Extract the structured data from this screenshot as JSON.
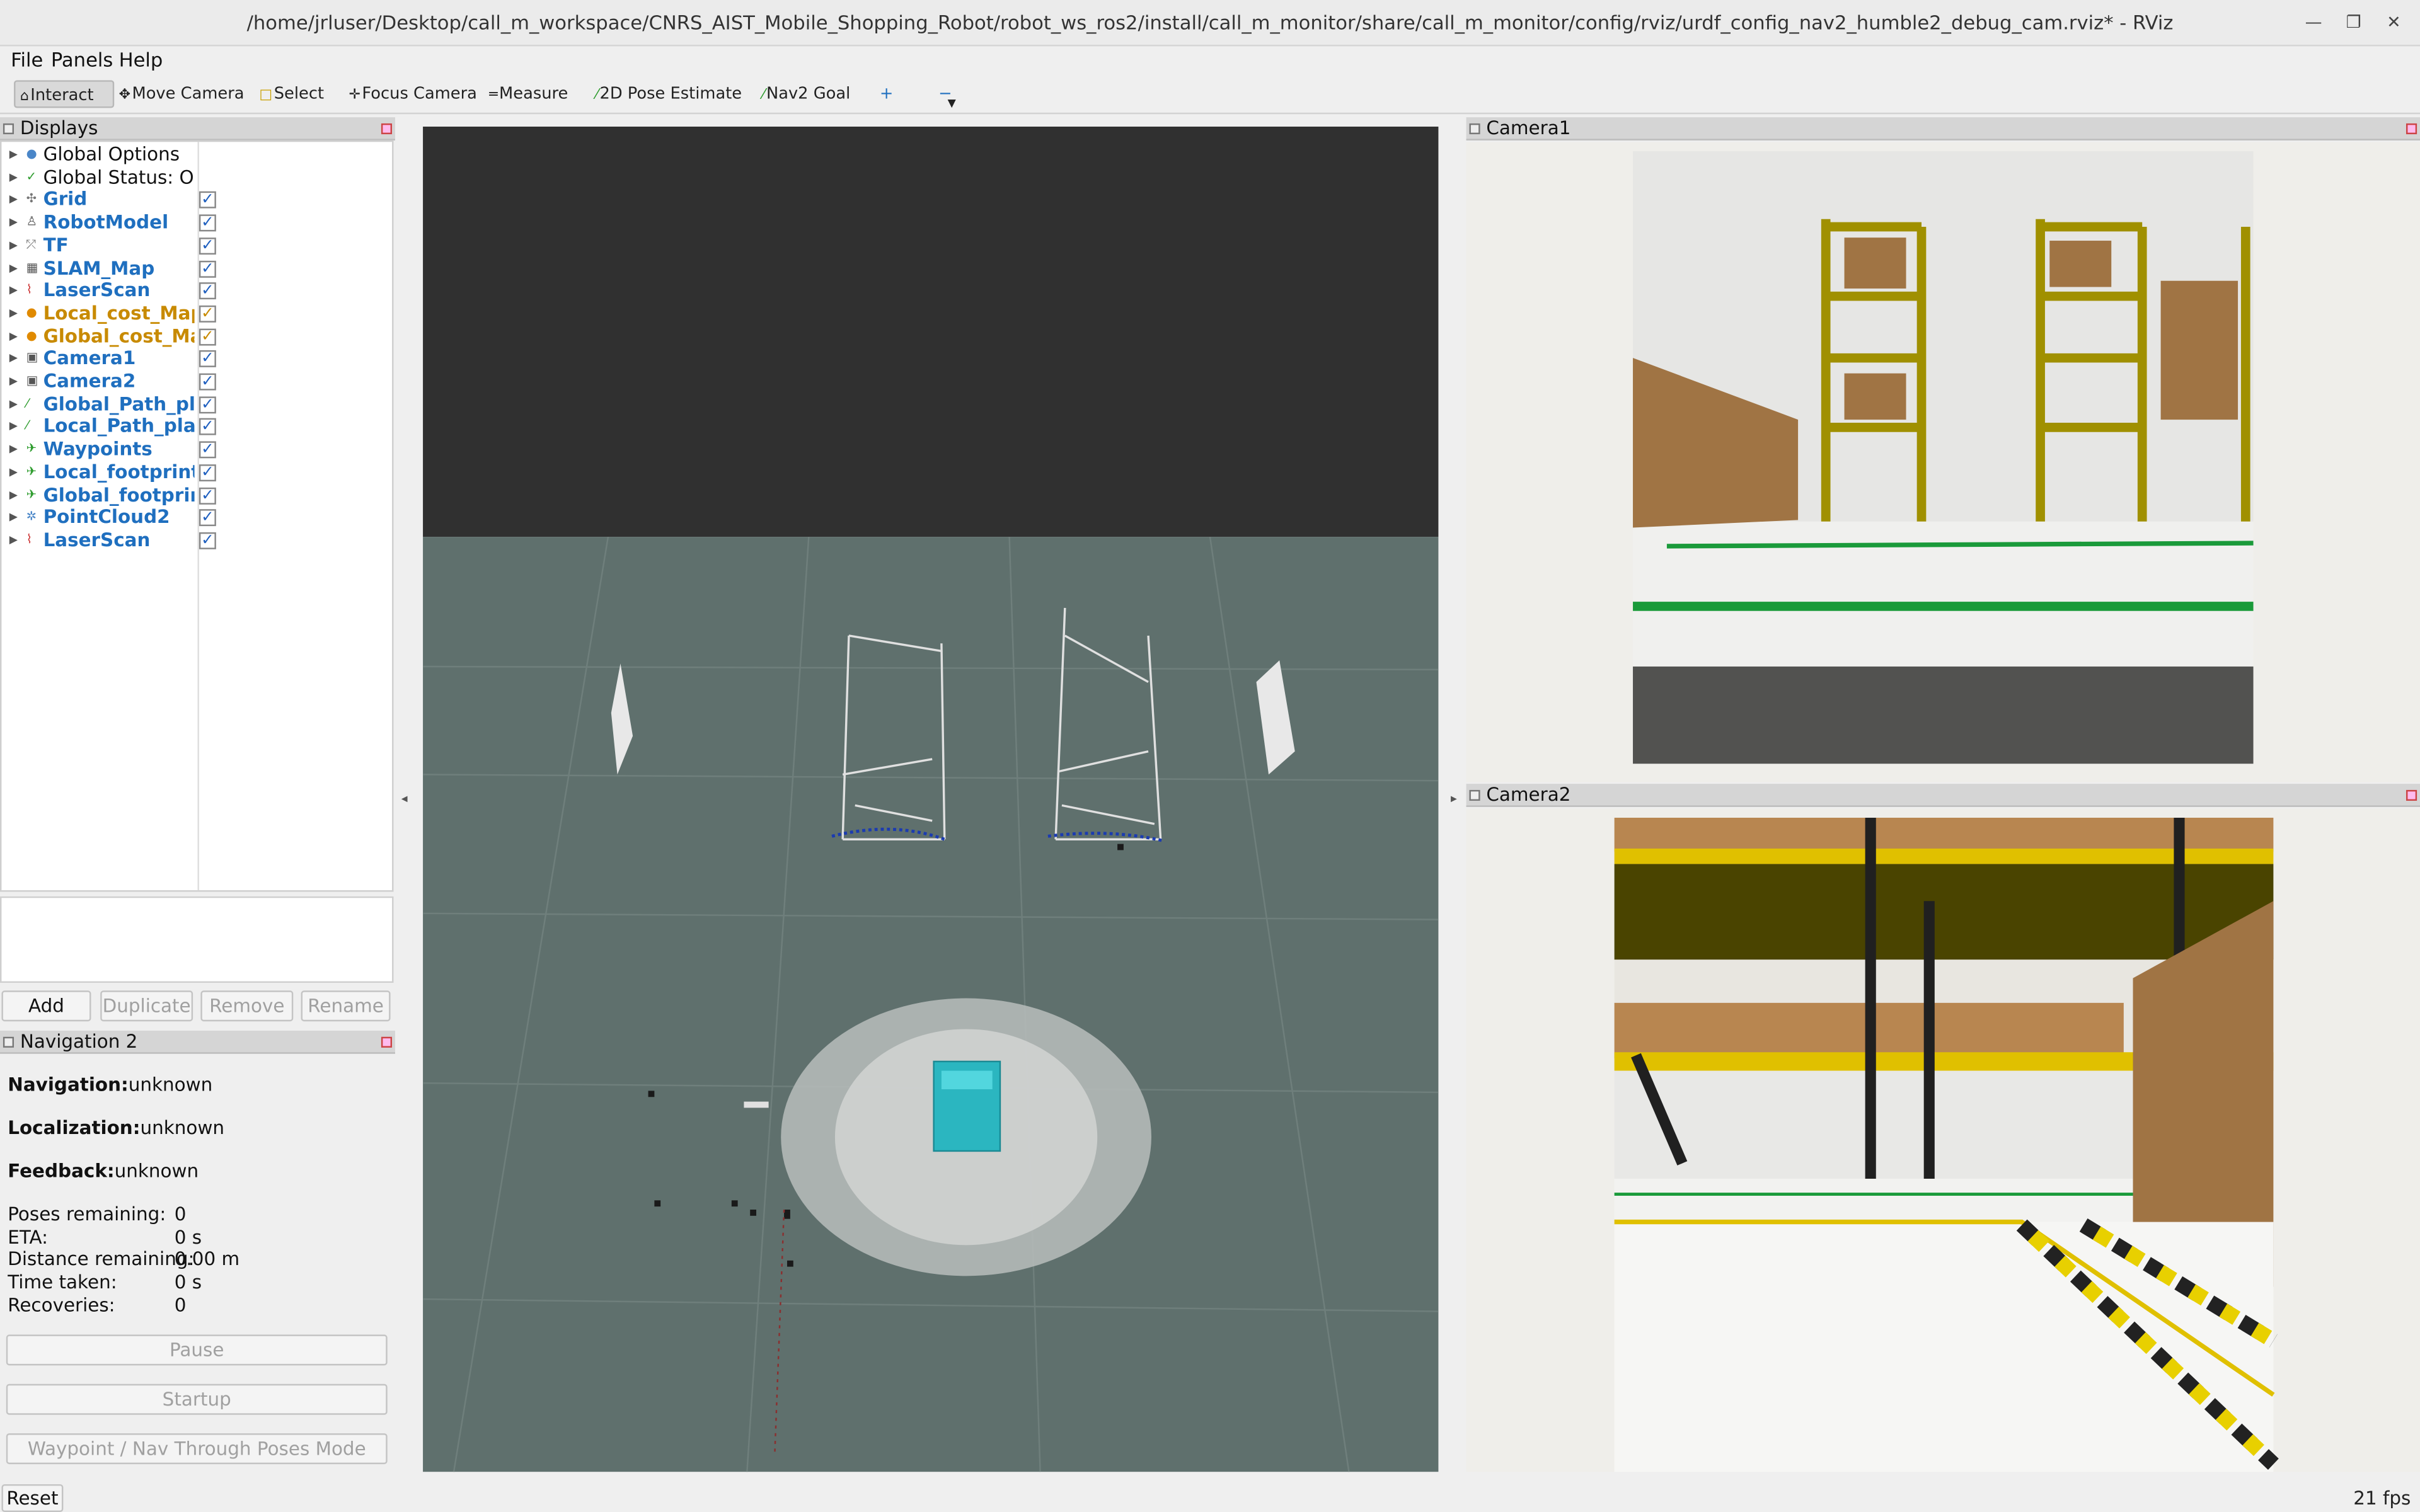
{
  "window": {
    "title": "/home/jrluser/Desktop/call_m_workspace/CNRS_AIST_Mobile_Shopping_Robot/robot_ws_ros2/install/call_m_monitor/share/call_m_monitor/config/rviz/urdf_config_nav2_humble2_debug_cam.rviz* - RViz"
  },
  "menu": {
    "file": "File",
    "panels": "Panels",
    "help": "Help"
  },
  "toolbar": {
    "interact": "Interact",
    "move_camera": "Move Camera",
    "select": "Select",
    "focus_camera": "Focus Camera",
    "measure": "Measure",
    "pose_estimate": "2D Pose Estimate",
    "nav2_goal": "Nav2 Goal",
    "plus": "+",
    "minus": "−"
  },
  "displays": {
    "title": "Displays",
    "items": [
      {
        "label": "Global Options",
        "color": "#111111",
        "checked": false,
        "has_check": false,
        "icon_color": "#4a86c8"
      },
      {
        "label": "Global Status: Ok",
        "color": "#111111",
        "checked": false,
        "has_check": false,
        "icon_color": "#2a9a2a"
      },
      {
        "label": "Grid",
        "color": "#1f6fbf",
        "checked": true,
        "has_check": true,
        "icon_color": "#777777"
      },
      {
        "label": "RobotModel",
        "color": "#1f6fbf",
        "checked": true,
        "has_check": true,
        "icon_color": "#555555"
      },
      {
        "label": "TF",
        "color": "#1f6fbf",
        "checked": true,
        "has_check": true,
        "icon_color": "#888888"
      },
      {
        "label": "SLAM_Map",
        "color": "#1f6fbf",
        "checked": true,
        "has_check": true,
        "icon_color": "#555555"
      },
      {
        "label": "LaserScan",
        "color": "#1f6fbf",
        "checked": true,
        "has_check": true,
        "icon_color": "#cc3333"
      },
      {
        "label": "Local_cost_Map",
        "color": "#c88a00",
        "checked": true,
        "has_check": true,
        "icon_color": "#e08a00"
      },
      {
        "label": "Global_cost_Map",
        "color": "#c88a00",
        "checked": true,
        "has_check": true,
        "icon_color": "#e08a00"
      },
      {
        "label": "Camera1",
        "color": "#1f6fbf",
        "checked": true,
        "has_check": true,
        "icon_color": "#555555"
      },
      {
        "label": "Camera2",
        "color": "#1f6fbf",
        "checked": true,
        "has_check": true,
        "icon_color": "#555555"
      },
      {
        "label": "Global_Path_pl...",
        "color": "#1f6fbf",
        "checked": true,
        "has_check": true,
        "icon_color": "#2a9a2a"
      },
      {
        "label": "Local_Path_pla...",
        "color": "#1f6fbf",
        "checked": true,
        "has_check": true,
        "icon_color": "#2a9a2a"
      },
      {
        "label": "Waypoints",
        "color": "#1f6fbf",
        "checked": true,
        "has_check": true,
        "icon_color": "#2a9a2a"
      },
      {
        "label": "Local_footprint",
        "color": "#1f6fbf",
        "checked": true,
        "has_check": true,
        "icon_color": "#2a9a2a"
      },
      {
        "label": "Global_footprint",
        "color": "#1f6fbf",
        "checked": true,
        "has_check": true,
        "icon_color": "#2a9a2a"
      },
      {
        "label": "PointCloud2",
        "color": "#1f6fbf",
        "checked": true,
        "has_check": true,
        "icon_color": "#4a86c8"
      },
      {
        "label": "LaserScan",
        "color": "#1f6fbf",
        "checked": true,
        "has_check": true,
        "icon_color": "#cc3333"
      }
    ],
    "buttons": {
      "add": "Add",
      "duplicate": "Duplicate",
      "remove": "Remove",
      "rename": "Rename"
    }
  },
  "navigation": {
    "title": "Navigation 2",
    "navigation_label": "Navigation:",
    "navigation_value": "unknown",
    "localization_label": "Localization:",
    "localization_value": "unknown",
    "feedback_label": "Feedback:",
    "feedback_value": "unknown",
    "stats": [
      {
        "label": "Poses remaining:",
        "value": "0"
      },
      {
        "label": "ETA:",
        "value": "0 s"
      },
      {
        "label": "Distance remaining:",
        "value": "0.00 m"
      },
      {
        "label": "Time taken:",
        "value": "0 s"
      },
      {
        "label": "Recoveries:",
        "value": "0"
      }
    ],
    "pause": "Pause",
    "startup": "Startup",
    "mode": "Waypoint / Nav Through Poses Mode"
  },
  "cameras": {
    "camera1_title": "Camera1",
    "camera2_title": "Camera2"
  },
  "status": {
    "reset": "Reset",
    "fps": "21 fps"
  }
}
